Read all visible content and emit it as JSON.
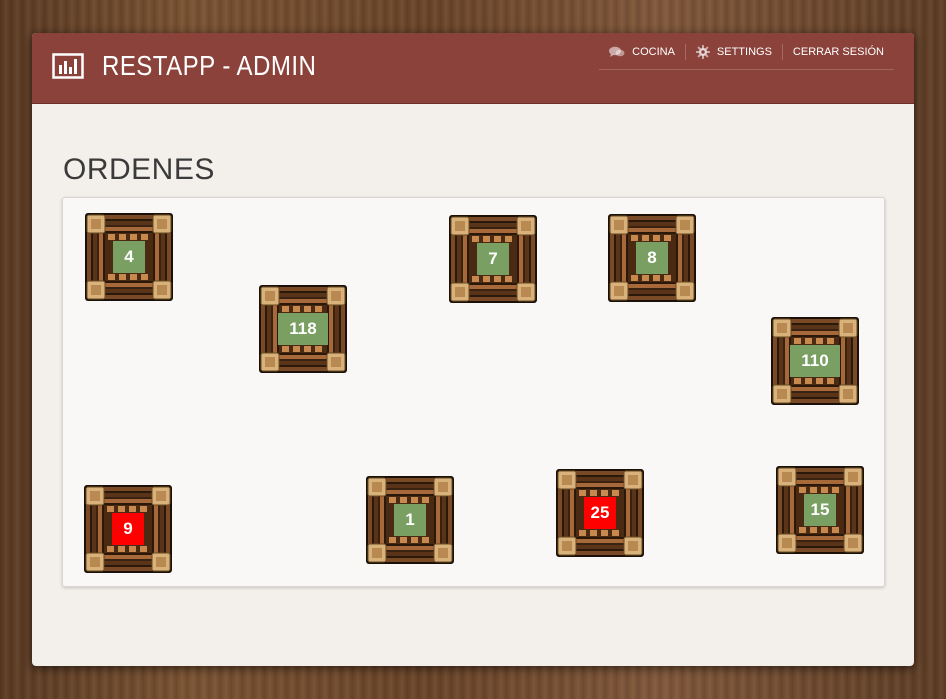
{
  "header": {
    "logo_icon": "bar-chart-icon",
    "title": "RESTAPP - ADMIN",
    "nav": [
      {
        "label": "COCINA",
        "icon": "chat-bubbles-icon"
      },
      {
        "label": "SETTINGS",
        "icon": "gear-icon"
      },
      {
        "label": "CERRAR SESIÓN"
      }
    ]
  },
  "main": {
    "section_title": "ORDENES",
    "tables": [
      {
        "number": "4",
        "status": "ok"
      },
      {
        "number": "118",
        "status": "ok"
      },
      {
        "number": "7",
        "status": "ok"
      },
      {
        "number": "8",
        "status": "ok"
      },
      {
        "number": "110",
        "status": "ok"
      },
      {
        "number": "9",
        "status": "alert"
      },
      {
        "number": "1",
        "status": "ok"
      },
      {
        "number": "25",
        "status": "alert"
      },
      {
        "number": "15",
        "status": "ok"
      }
    ]
  },
  "colors": {
    "header": "#8b423b",
    "badge_ok": "#7a9f62",
    "badge_alert": "#ff0000"
  }
}
